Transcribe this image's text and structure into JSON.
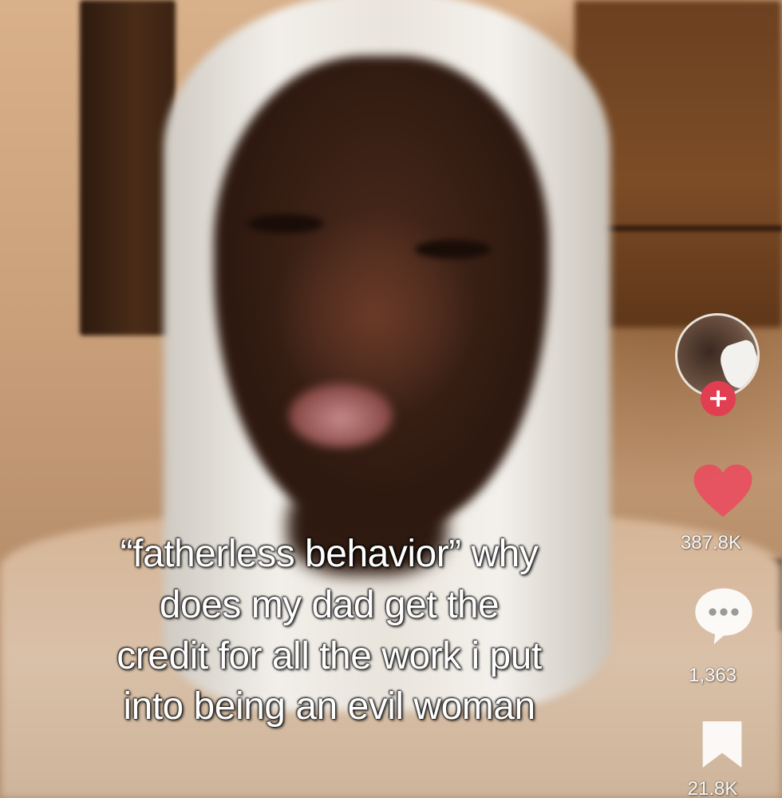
{
  "caption": {
    "lines": [
      "“fatherless behavior” why",
      "does my dad get the",
      "credit for all the work i put",
      "into being an evil woman"
    ]
  },
  "actions": {
    "follow_symbol": "+",
    "like_count": "387.8K",
    "comment_count": "1,363",
    "save_count": "21.8K",
    "icons": {
      "avatar": "profile-avatar",
      "follow": "plus-icon",
      "like": "heart-icon",
      "comment": "speech-bubble-icon",
      "save": "bookmark-icon"
    }
  },
  "colors": {
    "follow_red": "#e13e52",
    "like_red": "#e84e5e",
    "icon_white": "#ffffff"
  }
}
